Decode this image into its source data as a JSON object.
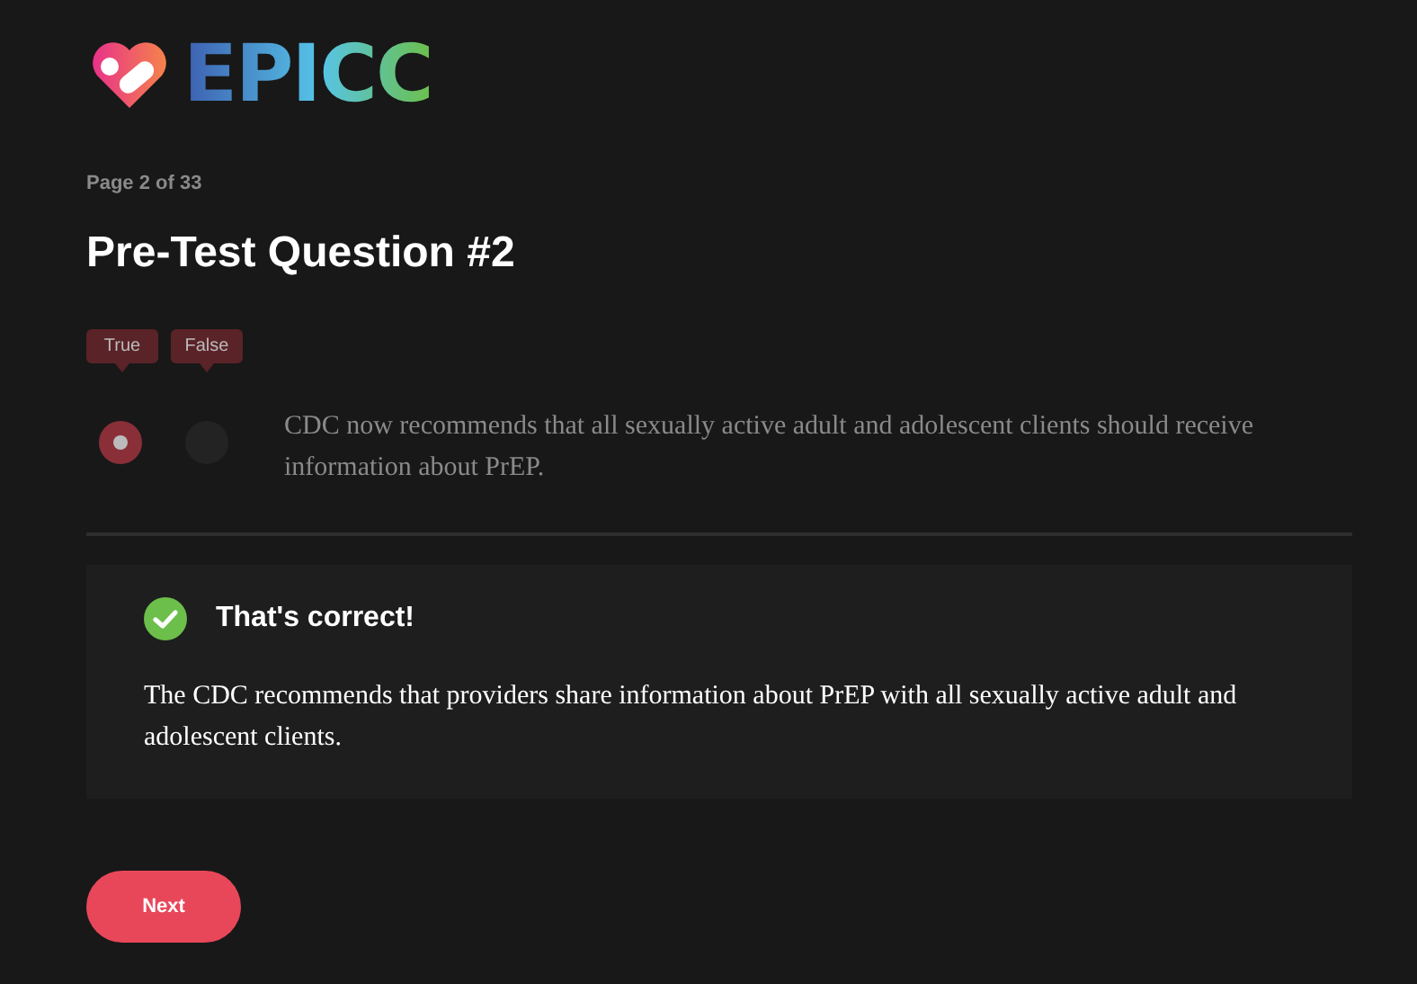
{
  "logo": {
    "text": "EPICC"
  },
  "page_indicator": "Page 2 of 33",
  "title": "Pre-Test Question #2",
  "options": [
    {
      "label": "True",
      "selected": true
    },
    {
      "label": "False",
      "selected": false
    }
  ],
  "question": "CDC now recommends that all sexually active adult and adolescent clients should receive information about PrEP.",
  "feedback": {
    "kind": "correct",
    "heading": "That's correct!",
    "body": "The CDC recommends that providers share information about PrEP with all sexually active adult and adolescent clients."
  },
  "next_button": "Next"
}
